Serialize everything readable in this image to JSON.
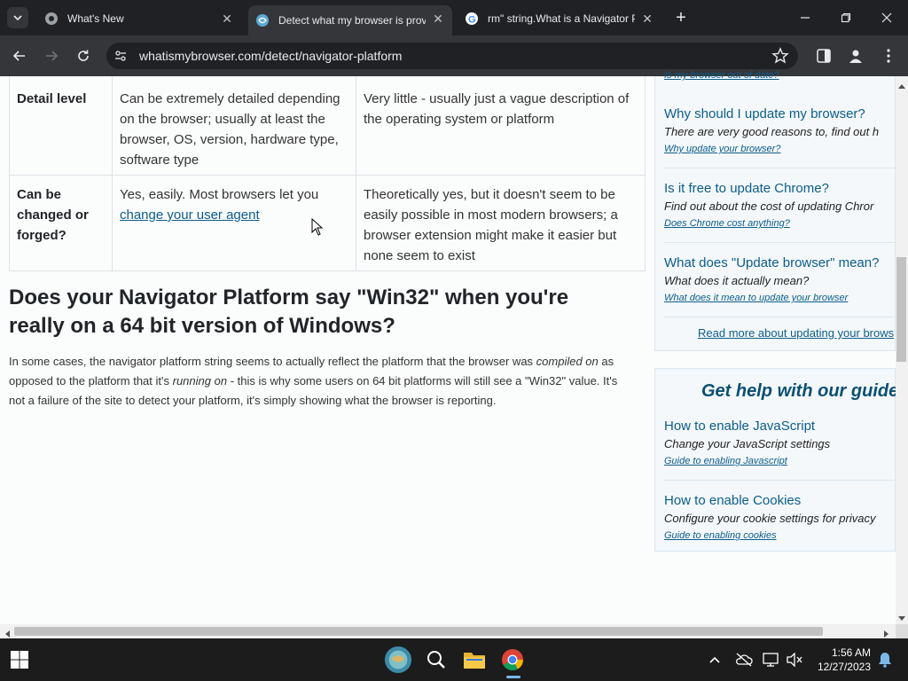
{
  "browser": {
    "tabs": [
      {
        "title": "What's New",
        "icon": "chrome-icon"
      },
      {
        "title": "Detect what my browser is prov",
        "icon": "wimb-icon"
      },
      {
        "title": "rm\" string.What is a Navigator P",
        "icon": "google-icon"
      }
    ],
    "url": "whatismybrowser.com/detect/navigator-platform"
  },
  "table": {
    "rows": [
      {
        "label": "Detail level",
        "col1": "Can be extremely detailed depending on the browser; usually at least the browser, OS, version, hardware type, software type",
        "col2": "Very little - usually just a vague description of the operating system or platform"
      },
      {
        "label": "Can be changed or forged?",
        "col1_text": "Yes, easily. Most browsers let you",
        "col1_link": "change your user agent",
        "col2": "Theoretically yes, but it doesn't seem to be easily possible in most modern browsers; a browser extension might make it easier but none seem to exist"
      }
    ]
  },
  "section": {
    "title": "Does your Navigator Platform say \"Win32\" when you're really on a 64 bit version of Windows?",
    "p1": "In some cases, the navigator platform string seems to actually reflect the platform that the browser was",
    "em1": "compiled on",
    "p2": "as opposed to the platform that it's",
    "em2": "running on",
    "p3": "- this is why some users on 64 bit platforms will still see a \"Win32\" value. It's not a failure of the site to detect your platform, it's simply showing what the browser is reporting."
  },
  "sidebar": {
    "top_link_cut": "Is my browser out of date?",
    "update_items": [
      {
        "q": "Why should I update my browser?",
        "d": "There are very good reasons to, find out h",
        "l": "Why update your browser?"
      },
      {
        "q": "Is it free to update Chrome?",
        "d": "Find out about the cost of updating Chror",
        "l": "Does Chrome cost anything?"
      },
      {
        "q": "What does \"Update browser\" mean?",
        "d": "What does it actually mean?",
        "l": "What does it mean to update your browser"
      }
    ],
    "read_more": "Read more about updating your brows",
    "guides_title": "Get help with our guide",
    "guides": [
      {
        "q": "How to enable JavaScript",
        "d": "Change your JavaScript settings",
        "l": "Guide to enabling Javascript"
      },
      {
        "q": "How to enable Cookies",
        "d": "Configure your cookie settings for privacy",
        "l": "Guide to enabling cookies"
      }
    ]
  },
  "taskbar": {
    "time": "1:56 AM",
    "date": "12/27/2023"
  },
  "colors": {
    "link": "#0b5d8a",
    "page_bg": "#fbfcfc",
    "sidebar_bg": "#f4f8fb",
    "chrome_dark": "#202124",
    "chrome_toolbar": "#35363a"
  }
}
